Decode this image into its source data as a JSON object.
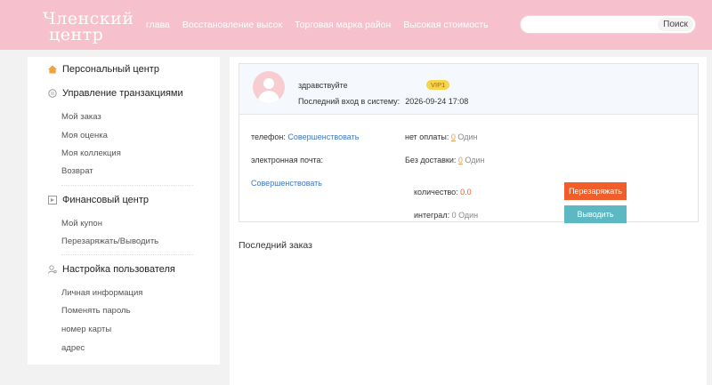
{
  "header": {
    "logo_line1": "Членский",
    "logo_line2": "центр",
    "nav": [
      "глава",
      "Восстановление высок",
      "Торговая марка район",
      "Высокая стоимость"
    ],
    "search_placeholder": "",
    "search_button": "Поиск",
    "bg_color": "#f6c1cd"
  },
  "sidebar": {
    "personal_center": {
      "label": "Персональный центр",
      "icon": "home-icon"
    },
    "transactions": {
      "title": "Управление транзакциями",
      "icon": "transaction-icon",
      "items": [
        "Мой заказ",
        "Моя оценка",
        "Моя коллекция",
        "Возврат"
      ]
    },
    "finance": {
      "title": "Финансовый центр",
      "icon": "finance-icon",
      "items": [
        "Мой купон",
        "Перезаряжать/Выводить"
      ]
    },
    "user_settings": {
      "title": "Настройка пользователя",
      "icon": "user-settings-icon",
      "items": [
        "Личная информация",
        "Поменять пароль",
        "номер карты",
        "адрес"
      ]
    }
  },
  "profile": {
    "greeting": "здравствуйте",
    "vip_badge": "VIP1",
    "last_login_label": "Последний вход в систему:",
    "last_login_value": "2026-09-24 17:08",
    "phone_label": "телефон:",
    "phone_link": "Совершенствовать",
    "email_label": "электронная почта:",
    "email_link": "Совершенствовать",
    "unpaid_label": "нет оплаты:",
    "unpaid_count": "0",
    "unpaid_unit": "Один",
    "undelivered_label": "Без доставки:",
    "undelivered_count": "0",
    "undelivered_unit": "Один",
    "balance_label": "количество:",
    "balance_value": "0.0",
    "points_label": "интеграл:",
    "points_value": "0 Один",
    "recharge_button": "Перезаряжать",
    "withdraw_button": "Выводить"
  },
  "orders": {
    "title": "Последний заказ"
  }
}
